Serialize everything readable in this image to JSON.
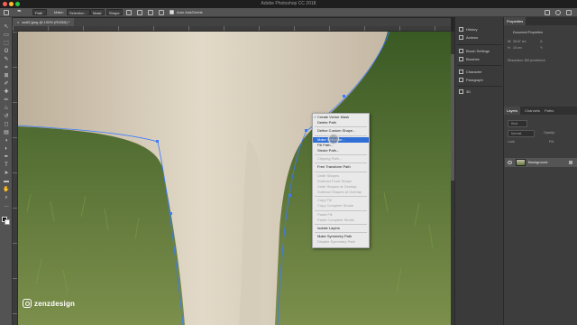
{
  "window": {
    "title": "Adobe Photoshop CC 2018",
    "controls": {
      "close": "#ff5f57",
      "minimize": "#febc2e",
      "zoom": "#28c840"
    }
  },
  "options_bar": {
    "home_icon": "home-icon",
    "tool_icon": "pen-icon",
    "mode_value": "Path",
    "make_label": "Make:",
    "selection_button": "Selection...",
    "mask_button": "Mask",
    "shape_button": "Shape",
    "auto_add_delete_label": "Auto Add/Delete"
  },
  "document": {
    "tab_label": "wolf2.jpeg @ 100% (RGB/8) *"
  },
  "toolbar": {
    "tools": [
      "move",
      "artboard",
      "marquee",
      "lasso",
      "quick-select",
      "crop",
      "frame",
      "eyedropper",
      "healing",
      "brush",
      "clone",
      "history",
      "eraser",
      "gradient",
      "blur",
      "dodge",
      "pen",
      "type",
      "path-select",
      "shape",
      "hand",
      "zoom",
      "more"
    ],
    "tool_icons": [
      "↖",
      "▭",
      "⬚",
      "ʘ",
      "✎",
      "⌗",
      "⊠",
      "✐",
      "✚",
      "✏",
      "♨",
      "↺",
      "◻",
      "▤",
      "◖",
      "◐",
      "✒",
      "T",
      "➤",
      "▬",
      "✋",
      "⌕",
      "…"
    ]
  },
  "context_menu": {
    "items": [
      {
        "label": "Create Vector Mask",
        "enabled": true,
        "checked": true
      },
      {
        "label": "Delete Path",
        "enabled": true
      },
      {
        "sep": true
      },
      {
        "label": "Define Custom Shape...",
        "enabled": true
      },
      {
        "sep": true
      },
      {
        "label": "Make Selection...",
        "enabled": true,
        "highlighted": true
      },
      {
        "label": "Fill Path...",
        "enabled": true
      },
      {
        "label": "Stroke Path...",
        "enabled": true
      },
      {
        "sep": true
      },
      {
        "label": "Clipping Path...",
        "enabled": false
      },
      {
        "sep": true
      },
      {
        "label": "Free Transform Path",
        "enabled": true
      },
      {
        "sep": true
      },
      {
        "label": "Unite Shapes",
        "enabled": false
      },
      {
        "label": "Subtract Front Shape",
        "enabled": false
      },
      {
        "label": "Unite Shapes at Overlap",
        "enabled": false
      },
      {
        "label": "Subtract Shapes at Overlap",
        "enabled": false
      },
      {
        "sep": true
      },
      {
        "label": "Copy Fill",
        "enabled": false
      },
      {
        "label": "Copy Complete Stroke",
        "enabled": false
      },
      {
        "sep": true
      },
      {
        "label": "Paste Fill",
        "enabled": false
      },
      {
        "label": "Paste Complete Stroke",
        "enabled": false
      },
      {
        "sep": true
      },
      {
        "label": "Isolate Layers",
        "enabled": true
      },
      {
        "sep": true
      },
      {
        "label": "Make Symmetry Path",
        "enabled": true
      },
      {
        "label": "Disable Symmetry Path",
        "enabled": false
      }
    ]
  },
  "watermark": {
    "text": "zenzdesign",
    "icon": "instagram-icon"
  },
  "middle_panel": {
    "items": [
      {
        "label": "History",
        "icon": "history-icon"
      },
      {
        "label": "Actions",
        "icon": "actions-icon"
      },
      {
        "label": "Brush Settings",
        "icon": "brush-settings-icon"
      },
      {
        "label": "Brushes",
        "icon": "brushes-icon"
      },
      {
        "label": "Character",
        "icon": "character-icon"
      },
      {
        "label": "Paragraph",
        "icon": "paragraph-icon"
      },
      {
        "label": "3D",
        "icon": "3d-icon"
      }
    ]
  },
  "properties_panel": {
    "tab": "Properties",
    "subtitle": "Document Properties",
    "w_label": "W:",
    "w_value": "26.67 cm",
    "h_label": "H:",
    "h_value": "15 cm",
    "x_label": "X:",
    "y_label": "Y:",
    "resolution": "Resolution: 300 pixels/inch"
  },
  "layers_panel": {
    "tabs": [
      "Layers",
      "Channels",
      "Paths"
    ],
    "kind_label": "Kind",
    "blend_mode": "Normal",
    "opacity_label": "Opacity:",
    "lock_label": "Lock:",
    "fill_label": "Fill:",
    "layer_name": "Background"
  },
  "colors": {
    "menu_highlight": "#2f6fd6",
    "path_stroke": "#3a7bff"
  }
}
